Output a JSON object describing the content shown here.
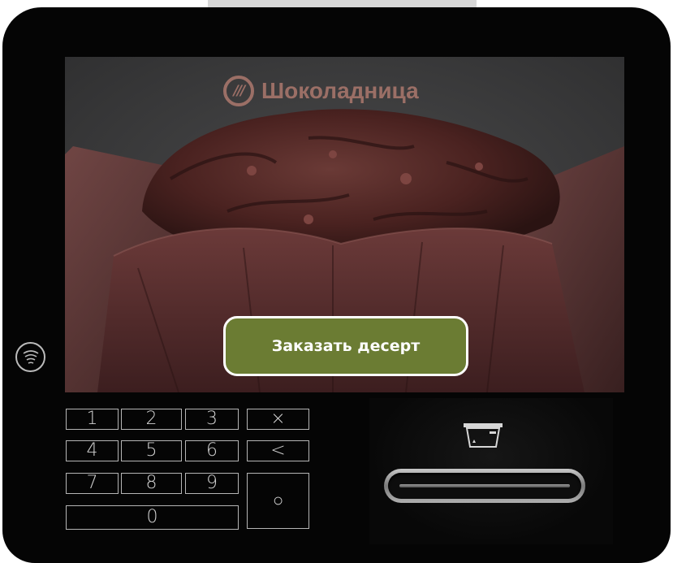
{
  "brand": {
    "name": "Шоколадница",
    "logo_text": "///"
  },
  "screen": {
    "order_button_label": "Заказать десерт"
  },
  "keypad": {
    "keys": [
      "1",
      "2",
      "3",
      "4",
      "5",
      "6",
      "7",
      "8",
      "9",
      "0"
    ],
    "cancel": "×",
    "backspace": "<",
    "confirm": "○"
  },
  "icons": {
    "nfc": "contactless-icon",
    "card": "card-insert-icon"
  },
  "colors": {
    "button": "#6b7c33",
    "brand": "#9b6f66",
    "bezel": "#050505"
  }
}
